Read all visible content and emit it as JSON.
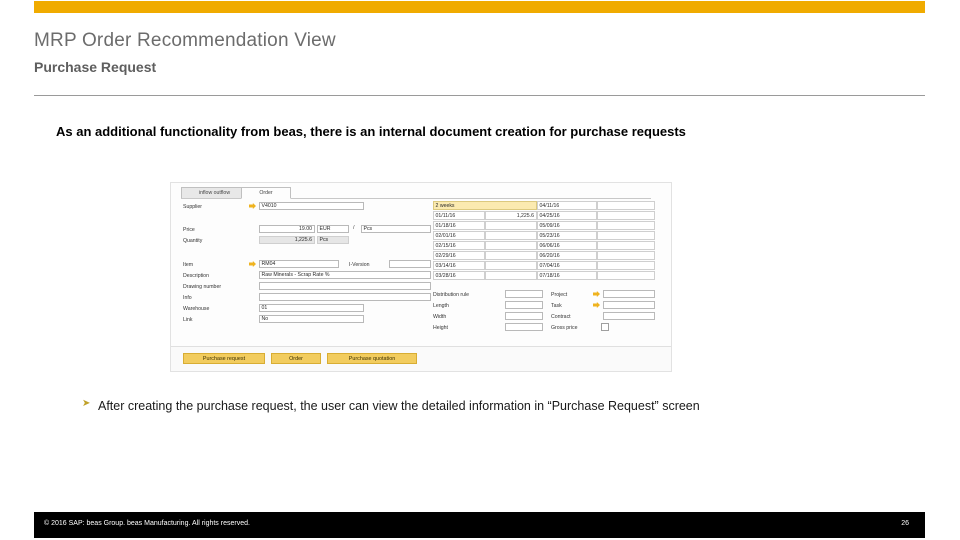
{
  "theme": {
    "accent": "#f0ab00",
    "footer_bg": "#000000",
    "highlight": "#fbeab0"
  },
  "header": {
    "title": "MRP Order Recommendation View",
    "subtitle": "Purchase Request"
  },
  "intro": {
    "text": "As an additional functionality from beas, there is an internal document creation for purchase requests"
  },
  "app": {
    "tabs": [
      {
        "label": "inflow  outflow",
        "active": false
      },
      {
        "label": "Order",
        "active": true
      }
    ],
    "left_form": {
      "supplier": {
        "label": "Supplier",
        "value": "V4010"
      },
      "price": {
        "label": "Price",
        "value": "19.00",
        "currency": "EUR",
        "separator": "/",
        "unit": "Pcs"
      },
      "quantity": {
        "label": "Quantity",
        "value": "1,225.6",
        "unit": "Pcs"
      },
      "item": {
        "label": "Item",
        "value": "RM04"
      },
      "iversion": {
        "label": "I-Version",
        "value": ""
      },
      "description": {
        "label": "Description",
        "value": "Raw Minerals - Scrap Rate  %"
      },
      "drawing_number": {
        "label": "Drawing number",
        "value": ""
      },
      "info": {
        "label": "Info",
        "value": ""
      },
      "warehouse": {
        "label": "Warehouse",
        "value": "01"
      },
      "link": {
        "label": "Link",
        "value": "No"
      }
    },
    "grid": {
      "header": {
        "period": "2 weeks",
        "date": "04/11/16",
        "value": ""
      },
      "rows": [
        {
          "date_left": "01/11/16",
          "qty": "1,225.6",
          "date_right": "04/25/16",
          "value": ""
        },
        {
          "date_left": "01/18/16",
          "qty": "",
          "date_right": "05/09/16",
          "value": ""
        },
        {
          "date_left": "02/01/16",
          "qty": "",
          "date_right": "05/23/16",
          "value": ""
        },
        {
          "date_left": "02/15/16",
          "qty": "",
          "date_right": "06/06/16",
          "value": ""
        },
        {
          "date_left": "02/29/16",
          "qty": "",
          "date_right": "06/20/16",
          "value": ""
        },
        {
          "date_left": "03/14/16",
          "qty": "",
          "date_right": "07/04/16",
          "value": ""
        },
        {
          "date_left": "03/28/16",
          "qty": "",
          "date_right": "07/18/16",
          "value": ""
        }
      ]
    },
    "dimensions": {
      "distribution_rule": {
        "label": "Distribution rule",
        "value": ""
      },
      "length": {
        "label": "Length",
        "value": ""
      },
      "width": {
        "label": "Width",
        "value": ""
      },
      "height": {
        "label": "Height",
        "value": ""
      },
      "project": {
        "label": "Project",
        "value": ""
      },
      "task": {
        "label": "Task",
        "value": ""
      },
      "contract": {
        "label": "Contract",
        "value": ""
      },
      "gross_price": {
        "label": "Gross price",
        "checked": false
      }
    },
    "buttons": [
      {
        "label": "Purchase request"
      },
      {
        "label": "Order"
      },
      {
        "label": "Purchase quotation"
      }
    ]
  },
  "bullet": {
    "marker": "➤",
    "text": "After creating the purchase request, the user can view the detailed information in “Purchase Request” screen"
  },
  "footer": {
    "copyright": "© 2016 SAP: beas Group. beas Manufacturing.  All rights reserved.",
    "page": "26"
  }
}
